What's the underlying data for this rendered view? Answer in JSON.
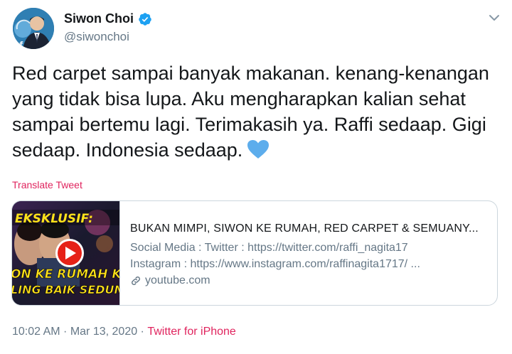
{
  "user": {
    "display_name": "Siwon Choi",
    "handle": "@siwonchoi",
    "verified": true
  },
  "tweet": {
    "text": "Red carpet sampai banyak makanan. kenang-kenangan yang tidak bisa lupa. Aku mengharapkan kalian sehat sampai bertemu lagi. Terimakasih ya. Raffi sedaap. Gigi sedaap. Indonesia sedaap.",
    "emoji": "blue-heart",
    "translate_label": "Translate Tweet"
  },
  "card": {
    "thumbnail_text_top": "EKSKLUSIF:",
    "thumbnail_text_mid": "ON KE RUMAH KIT",
    "thumbnail_text_bottom": "LING BAIK SEDUNIA",
    "title": "BUKAN MIMPI, SIWON KE RUMAH, RED CARPET & SEMUANY...",
    "description_lines": [
      "Social Media : Twitter : https://twitter.com/raffi_nagita17",
      "Instagram : https://www.instagram.com/raffinagita1717/ ..."
    ],
    "domain": "youtube.com"
  },
  "meta": {
    "time": "10:02 AM",
    "separator": " · ",
    "date": "Mar 13, 2020",
    "source": "Twitter for iPhone"
  },
  "colors": {
    "accent_pink": "#e0245e",
    "verified_blue": "#1da1f2",
    "heart_blue": "#5dadec",
    "muted_text": "#657786",
    "youtube_red": "#e62117",
    "thumb_text_yellow": "#ffe21a"
  }
}
